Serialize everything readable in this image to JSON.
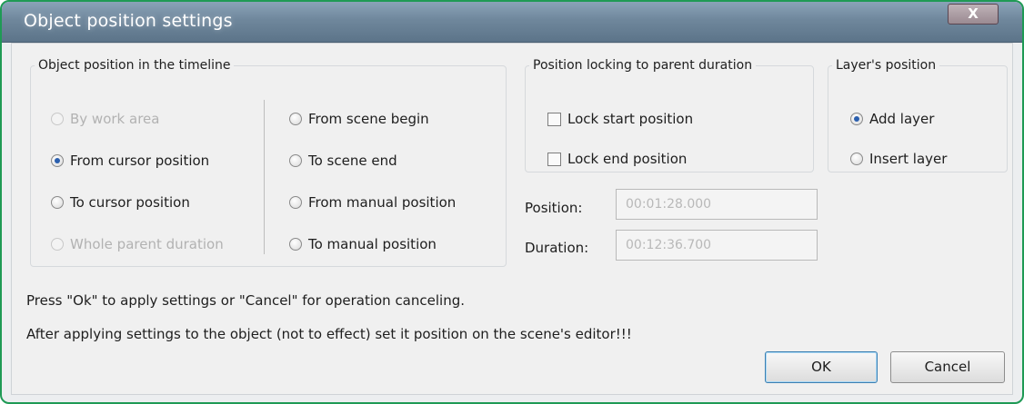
{
  "window": {
    "title": "Object position settings",
    "close_label": "X"
  },
  "timeline_group": {
    "legend": "Object position in the timeline",
    "options_left": [
      {
        "label": "By work area",
        "checked": false,
        "disabled": true
      },
      {
        "label": "From cursor position",
        "checked": true,
        "disabled": false
      },
      {
        "label": "To cursor position",
        "checked": false,
        "disabled": false
      },
      {
        "label": "Whole parent duration",
        "checked": false,
        "disabled": true
      }
    ],
    "options_right": [
      {
        "label": "From scene begin",
        "checked": false,
        "disabled": false
      },
      {
        "label": "To scene end",
        "checked": false,
        "disabled": false
      },
      {
        "label": "From manual position",
        "checked": false,
        "disabled": false
      },
      {
        "label": "To manual position",
        "checked": false,
        "disabled": false
      }
    ]
  },
  "locking_group": {
    "legend": "Position locking to parent duration",
    "checkboxes": [
      {
        "label": "Lock start position",
        "checked": false
      },
      {
        "label": "Lock end position",
        "checked": false
      }
    ]
  },
  "layer_group": {
    "legend": "Layer's position",
    "options": [
      {
        "label": "Add layer",
        "checked": true
      },
      {
        "label": "Insert layer",
        "checked": false
      }
    ]
  },
  "fields": {
    "position_label": "Position:",
    "position_value": "00:01:28.000",
    "duration_label": "Duration:",
    "duration_value": "00:12:36.700"
  },
  "info": {
    "line1": "Press \"Ok\" to apply settings or \"Cancel\" for operation canceling.",
    "line2": "After applying settings to the object (not to effect) set it position on the scene's editor!!!"
  },
  "buttons": {
    "ok": "OK",
    "cancel": "Cancel"
  },
  "colors": {
    "frame_border": "#1f9a55",
    "radio_dot": "#2b5fae",
    "disabled_text": "#b2b2b2"
  }
}
